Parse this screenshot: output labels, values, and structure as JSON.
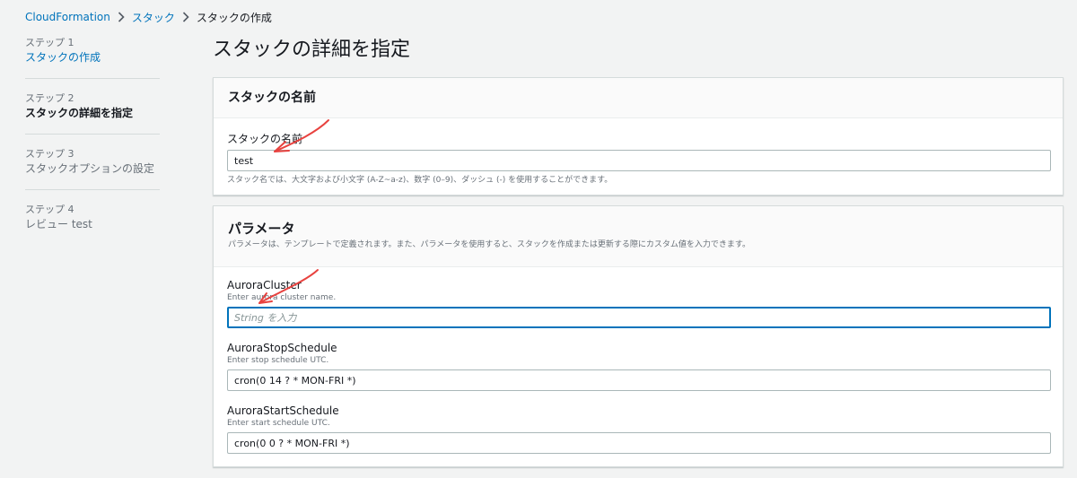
{
  "breadcrumb": {
    "items": [
      "CloudFormation",
      "スタック",
      "スタックの作成"
    ]
  },
  "sidebar": {
    "steps": [
      {
        "label": "ステップ 1",
        "title": "スタックの作成",
        "state": "link"
      },
      {
        "label": "ステップ 2",
        "title": "スタックの詳細を指定",
        "state": "active"
      },
      {
        "label": "ステップ 3",
        "title": "スタックオプションの設定",
        "state": "disabled"
      },
      {
        "label": "ステップ 4",
        "title": "レビュー test",
        "state": "disabled"
      }
    ]
  },
  "main": {
    "title": "スタックの詳細を指定",
    "stack_name_panel": {
      "title": "スタックの名前",
      "field_label": "スタックの名前",
      "value": "test",
      "hint": "スタック名では、大文字および小文字 (A-Z~a-z)、数字 (0–9)、ダッシュ (-) を使用することができます。"
    },
    "parameters_panel": {
      "title": "パラメータ",
      "description": "パラメータは、テンプレートで定義されます。また、パラメータを使用すると、スタックを作成または更新する際にカスタム値を入力できます。",
      "params": [
        {
          "name": "AuroraCluster",
          "description": "Enter aurora cluster name.",
          "value": "",
          "placeholder": "String を入力"
        },
        {
          "name": "AuroraStopSchedule",
          "description": "Enter stop schedule UTC.",
          "value": "cron(0 14 ? * MON-FRI *)",
          "placeholder": ""
        },
        {
          "name": "AuroraStartSchedule",
          "description": "Enter start schedule UTC.",
          "value": "cron(0 0 ? * MON-FRI *)",
          "placeholder": ""
        }
      ]
    }
  },
  "colors": {
    "background": "#f2f3f3",
    "link": "#0073bb",
    "annotation_arrow": "#e8423f",
    "focus_border": "#0073bb"
  }
}
